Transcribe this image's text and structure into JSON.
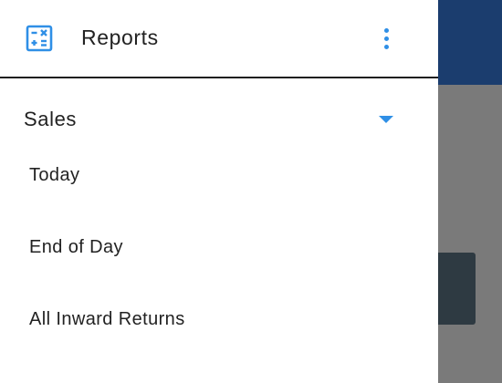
{
  "header": {
    "icon": "calculator-icon",
    "title": "Reports",
    "more_icon": "more-vertical-icon"
  },
  "section": {
    "title": "Sales",
    "caret_icon": "caret-down-icon",
    "items": [
      {
        "label": "Today"
      },
      {
        "label": "End of Day"
      },
      {
        "label": "All Inward Returns"
      }
    ]
  },
  "colors": {
    "accent": "#2f8fe6",
    "app_bar_dimmed": "#1b3d6e",
    "scrim": "#7a7a7a"
  }
}
